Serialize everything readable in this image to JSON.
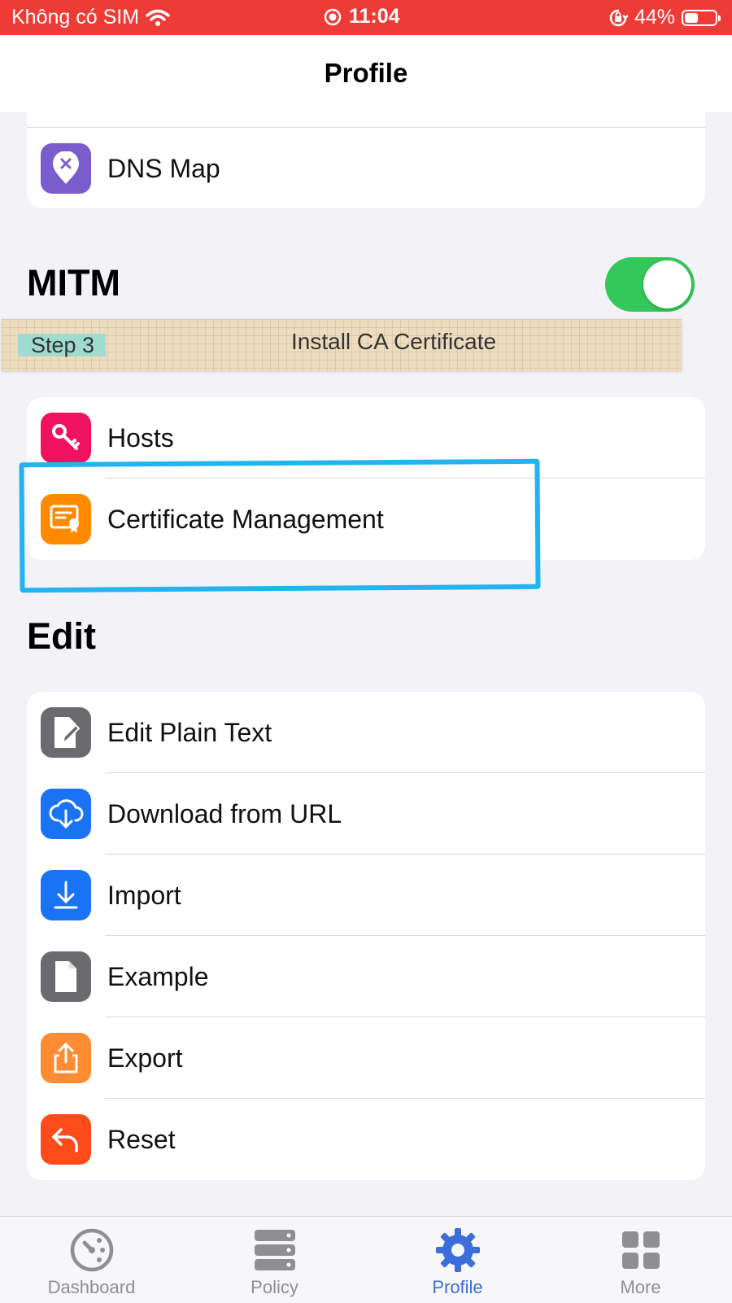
{
  "status_bar": {
    "carrier": "Không có SIM",
    "time": "11:04",
    "battery": "44%",
    "battery_level": 0.44,
    "bg_color": "#ef3b36"
  },
  "nav": {
    "title": "Profile"
  },
  "top_group": {
    "items": [
      {
        "label": "DNS Map",
        "icon": "map-pin-x-icon",
        "color": "#7b5ccc"
      }
    ]
  },
  "mitm": {
    "title": "MITM",
    "toggle_on": true,
    "toggle_color": "#34c759",
    "items": [
      {
        "label": "Hosts",
        "icon": "key-icon",
        "color": "#f0125e"
      },
      {
        "label": "Certificate Management",
        "icon": "certificate-icon",
        "color": "#ff8a00"
      }
    ]
  },
  "tape": {
    "step": "Step 3",
    "text": "Install CA Certificate"
  },
  "edit": {
    "title": "Edit",
    "items": [
      {
        "label": "Edit Plain Text",
        "icon": "edit-document-icon",
        "color": "#6b6b6f"
      },
      {
        "label": "Download from URL",
        "icon": "cloud-download-icon",
        "color": "#1a73f5"
      },
      {
        "label": "Import",
        "icon": "import-icon",
        "color": "#1a73f5"
      },
      {
        "label": "Example",
        "icon": "document-icon",
        "color": "#6b6b6f"
      },
      {
        "label": "Export",
        "icon": "export-icon",
        "color": "#ff8c33"
      },
      {
        "label": "Reset",
        "icon": "reset-arrow-icon",
        "color": "#ff4a1a"
      }
    ]
  },
  "tabs": [
    {
      "label": "Dashboard",
      "icon": "dashboard-gauge-icon",
      "active": false
    },
    {
      "label": "Policy",
      "icon": "server-icon",
      "active": false
    },
    {
      "label": "Profile",
      "icon": "gear-icon",
      "active": true
    },
    {
      "label": "More",
      "icon": "grid-icon",
      "active": false
    }
  ],
  "colors": {
    "accent": "#3b6ddb",
    "inactive": "#8e8e93",
    "highlight": "#21b4f0"
  }
}
